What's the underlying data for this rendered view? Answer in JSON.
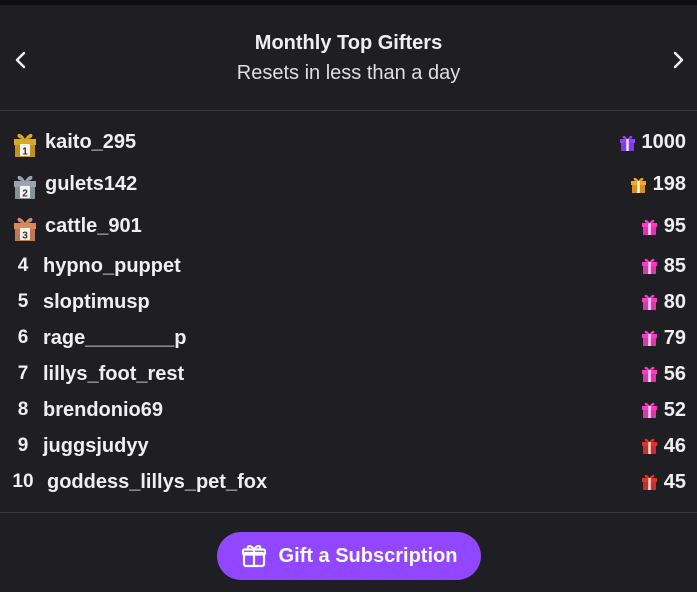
{
  "header": {
    "title": "Monthly Top Gifters",
    "subtitle": "Resets in less than a day"
  },
  "leaders": [
    {
      "rank": "1",
      "name": "kaito_295",
      "amount": "1000",
      "badge_color": "#d9a826",
      "gift_color": "#8e44ff"
    },
    {
      "rank": "2",
      "name": "gulets142",
      "amount": "198",
      "badge_color": "#9aa6ad",
      "gift_color": "#f5a623"
    },
    {
      "rank": "3",
      "name": "cattle_901",
      "amount": "95",
      "badge_color": "#d98a5c",
      "gift_color": "#ff38c8"
    },
    {
      "rank": "4",
      "name": "hypno_puppet",
      "amount": "85",
      "gift_color": "#ff38c8"
    },
    {
      "rank": "5",
      "name": "sloptimusp",
      "amount": "80",
      "gift_color": "#ff38c8"
    },
    {
      "rank": "6",
      "name": "rage________p",
      "amount": "79",
      "gift_color": "#ff38c8"
    },
    {
      "rank": "7",
      "name": "lillys_foot_rest",
      "amount": "56",
      "gift_color": "#ff38c8"
    },
    {
      "rank": "8",
      "name": "brendonio69",
      "amount": "52",
      "gift_color": "#ff38c8"
    },
    {
      "rank": "9",
      "name": "juggsjudyy",
      "amount": "46",
      "gift_color": "#e8302a"
    },
    {
      "rank": "10",
      "name": "goddess_lillys_pet_fox",
      "amount": "45",
      "gift_color": "#e8302a"
    }
  ],
  "button": {
    "label": "Gift a Subscription",
    "icon": "gift-icon",
    "color": "#9147ff"
  },
  "icons": {
    "prev": "chevron-left-icon",
    "next": "chevron-right-icon"
  }
}
